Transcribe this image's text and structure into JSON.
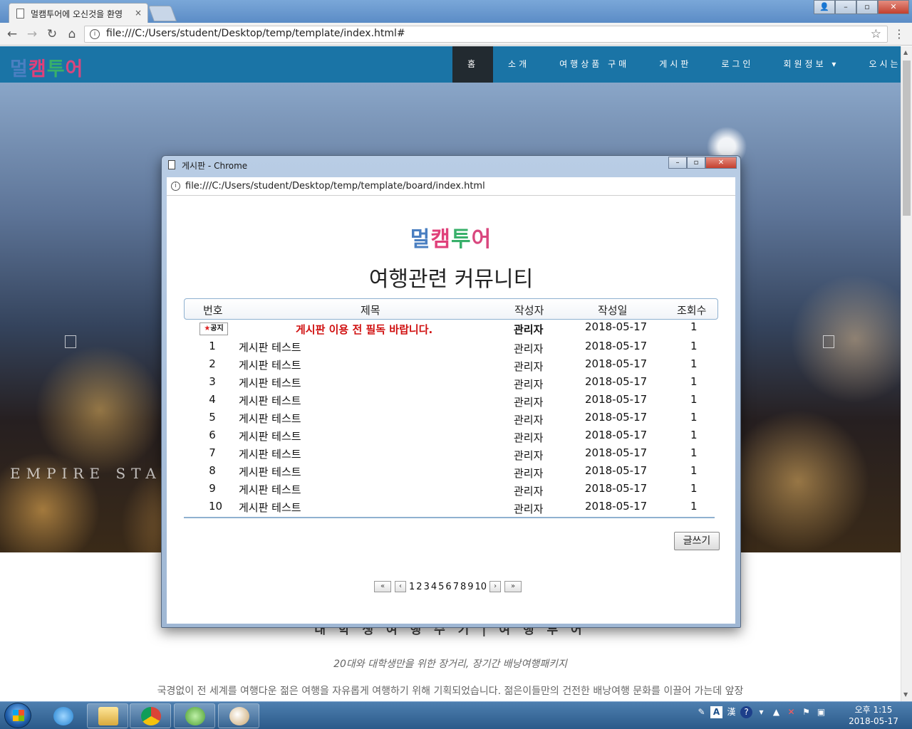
{
  "browser": {
    "tab_title": "멀캠투어에 오신것을 환영",
    "tab_close": "×",
    "address": "file:///C:/Users/student/Desktop/temp/template/index.html#",
    "nav_back": "←",
    "nav_forward": "→",
    "nav_reload": "↻",
    "nav_home": "⌂",
    "star": "☆",
    "menu": "⋮",
    "info": "i",
    "win_min": "–",
    "win_max": "▫",
    "win_close": "✕",
    "user_icon": "👤"
  },
  "site": {
    "logo": "멀캠투어",
    "nav": [
      "홈",
      "소개",
      "여행상품 구매",
      "게시판",
      "로그인",
      "회원정보 ▾",
      "오시는 길",
      "□"
    ],
    "hero_text": "EMPIRE STAT",
    "lower_title": "대 학 생 여 행 수 기 | 여 행 투 어",
    "lower_subtitle": "20대와 대학생만을 위한 장거리, 장기간 배낭여행패키지",
    "lower_desc": "국경없이 전 세계를 여행다운 젊은 여행을 자유롭게 여행하기 위해 기획되었습니다. 젊은이들만의 건전한 배낭여행 문화를 이끌어 가는데 앞장"
  },
  "popup": {
    "window_title": "게시판 - Chrome",
    "address": "file:///C:/Users/student/Desktop/temp/template/board/index.html",
    "min": "–",
    "max": "▫",
    "close": "✕",
    "logo": "멀캠투어",
    "board_title": "여행관련 커뮤니티",
    "columns": [
      "번호",
      "제목",
      "작성자",
      "작성일",
      "조회수"
    ],
    "notice": {
      "badge_star": "★",
      "badge": "공지",
      "title": "게시판 이용 전 필독 바랍니다.",
      "author": "관리자",
      "date": "2018-05-17",
      "views": "1"
    },
    "rows": [
      {
        "no": "1",
        "title": "게시판 테스트",
        "author": "관리자",
        "date": "2018-05-17",
        "views": "1"
      },
      {
        "no": "2",
        "title": "게시판 테스트",
        "author": "관리자",
        "date": "2018-05-17",
        "views": "1"
      },
      {
        "no": "3",
        "title": "게시판 테스트",
        "author": "관리자",
        "date": "2018-05-17",
        "views": "1"
      },
      {
        "no": "4",
        "title": "게시판 테스트",
        "author": "관리자",
        "date": "2018-05-17",
        "views": "1"
      },
      {
        "no": "5",
        "title": "게시판 테스트",
        "author": "관리자",
        "date": "2018-05-17",
        "views": "1"
      },
      {
        "no": "6",
        "title": "게시판 테스트",
        "author": "관리자",
        "date": "2018-05-17",
        "views": "1"
      },
      {
        "no": "7",
        "title": "게시판 테스트",
        "author": "관리자",
        "date": "2018-05-17",
        "views": "1"
      },
      {
        "no": "8",
        "title": "게시판 테스트",
        "author": "관리자",
        "date": "2018-05-17",
        "views": "1"
      },
      {
        "no": "9",
        "title": "게시판 테스트",
        "author": "관리자",
        "date": "2018-05-17",
        "views": "1"
      },
      {
        "no": "10",
        "title": "게시판 테스트",
        "author": "관리자",
        "date": "2018-05-17",
        "views": "1"
      }
    ],
    "write_button": "글쓰기",
    "pager": {
      "first": "«",
      "prev": "‹",
      "pages": [
        "1",
        "2",
        "3",
        "4",
        "5",
        "6",
        "7",
        "8",
        "9",
        "10"
      ],
      "next": "›",
      "last": "»"
    }
  },
  "taskbar": {
    "tray": [
      "✎",
      "A",
      "漢",
      "?",
      "▾",
      "▲",
      "✕",
      "⚑",
      "▣"
    ],
    "time": "오후 1:15",
    "date": "2018-05-17"
  },
  "colors": {
    "site_nav": "#1a74a6",
    "nav_active": "#222a30",
    "notice_red": "#d01010",
    "logo": [
      "#4a7fc1",
      "#e0407a",
      "#38b06a",
      "#d9477e"
    ]
  }
}
